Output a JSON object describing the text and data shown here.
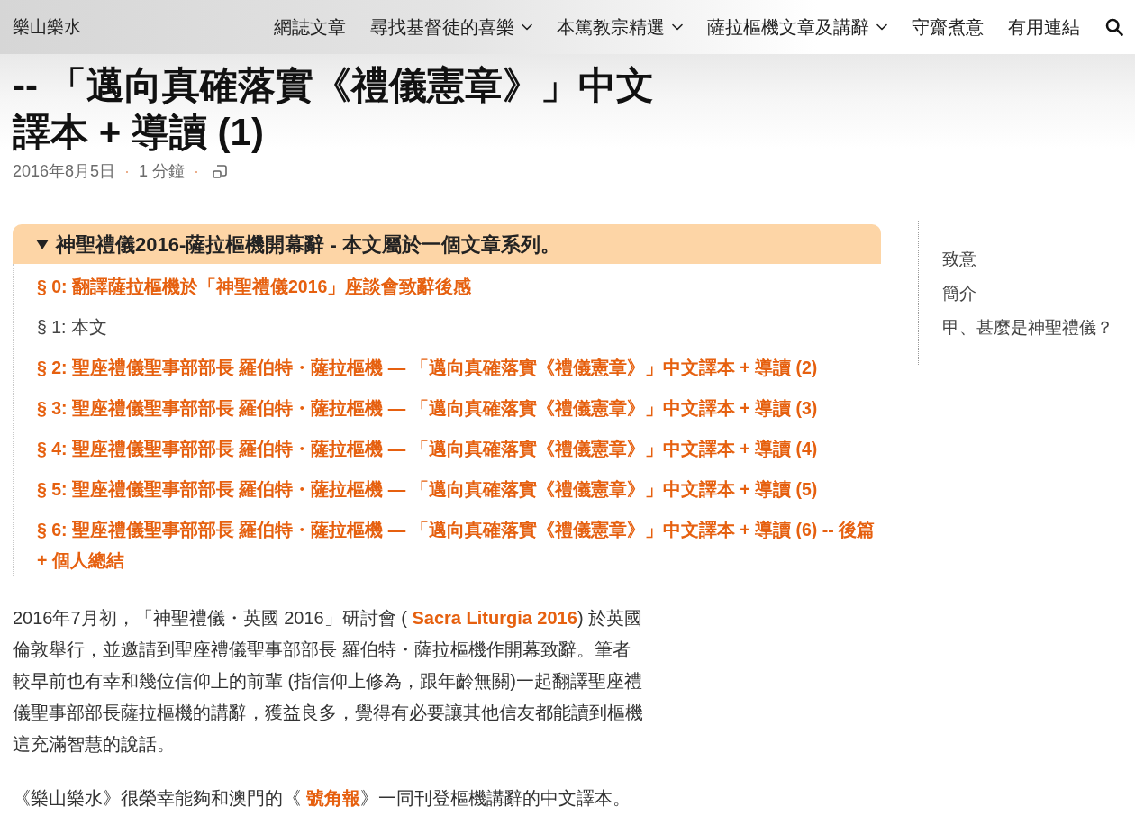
{
  "header": {
    "logo": "樂山樂水",
    "nav": [
      {
        "label": "網誌文章",
        "has_menu": false
      },
      {
        "label": "尋找基督徒的喜樂",
        "has_menu": true
      },
      {
        "label": "本篤教宗精選",
        "has_menu": true
      },
      {
        "label": "薩拉樞機文章及講辭",
        "has_menu": true
      },
      {
        "label": "守齋煮意",
        "has_menu": false
      },
      {
        "label": "有用連結",
        "has_menu": false
      }
    ]
  },
  "post": {
    "title": "-- 「邁向真確落實《禮儀憲章》」中文譯本 + 導讀 (1)",
    "meta": {
      "date": "2016年8月5日",
      "reading_time": "1 分鐘",
      "separators": [
        "·",
        "·"
      ]
    }
  },
  "series": {
    "expanded": true,
    "title": "神聖禮儀2016-薩拉樞機開幕辭 - 本文屬於一個文章系列。",
    "items": [
      {
        "text": "§ 0: 翻譯薩拉樞機於「神聖禮儀2016」座談會致辭後感",
        "selected": false
      },
      {
        "text": "§ 1: 本文",
        "selected": true
      },
      {
        "text": "§ 2: 聖座禮儀聖事部部長 羅伯特・薩拉樞機 — 「邁向真確落實《禮儀憲章》」中文譯本 + 導讀 (2)",
        "selected": false
      },
      {
        "text": "§ 3: 聖座禮儀聖事部部長 羅伯特・薩拉樞機 — 「邁向真確落實《禮儀憲章》」中文譯本 + 導讀 (3)",
        "selected": false
      },
      {
        "text": "§ 4: 聖座禮儀聖事部部長 羅伯特・薩拉樞機 — 「邁向真確落實《禮儀憲章》」中文譯本 + 導讀 (4)",
        "selected": false
      },
      {
        "text": "§ 5: 聖座禮儀聖事部部長 羅伯特・薩拉樞機 — 「邁向真確落實《禮儀憲章》」中文譯本 + 導讀 (5)",
        "selected": false
      },
      {
        "text": "§ 6: 聖座禮儀聖事部部長 羅伯特・薩拉樞機 — 「邁向真確落實《禮儀憲章》」中文譯本 + 導讀 (6) -- 後篇 + 個人總結",
        "selected": false
      }
    ]
  },
  "toc": {
    "items": [
      "致意",
      "簡介",
      "甲、甚麼是神聖禮儀？"
    ]
  },
  "body": {
    "paragraphs": [
      [
        {
          "kind": "text",
          "text": "2016年7月初，「神聖禮儀・英國 2016」研討會 ( "
        },
        {
          "kind": "link",
          "text": "Sacra Liturgia 2016"
        },
        {
          "kind": "text",
          "text": ") 於英國倫敦舉行，並邀請到聖座禮儀聖事部部長 羅伯特・薩拉樞機作開幕致辭。筆者較早前也有幸和幾位信仰上的前輩 (指信仰上修為，跟年齡無關)一起翻譯聖座禮儀聖事部部長薩拉樞機的講辭，獲益良多，覺得有必要讓其他信友都能讀到樞機這充滿智慧的說話。"
        }
      ],
      [
        {
          "kind": "text",
          "text": "《樂山樂水》很榮幸能夠和澳門的《 "
        },
        {
          "kind": "link",
          "text": "號角報"
        },
        {
          "kind": "text",
          "text": "》一同刊登樞機講辭的中文譯本。"
        }
      ]
    ]
  }
}
